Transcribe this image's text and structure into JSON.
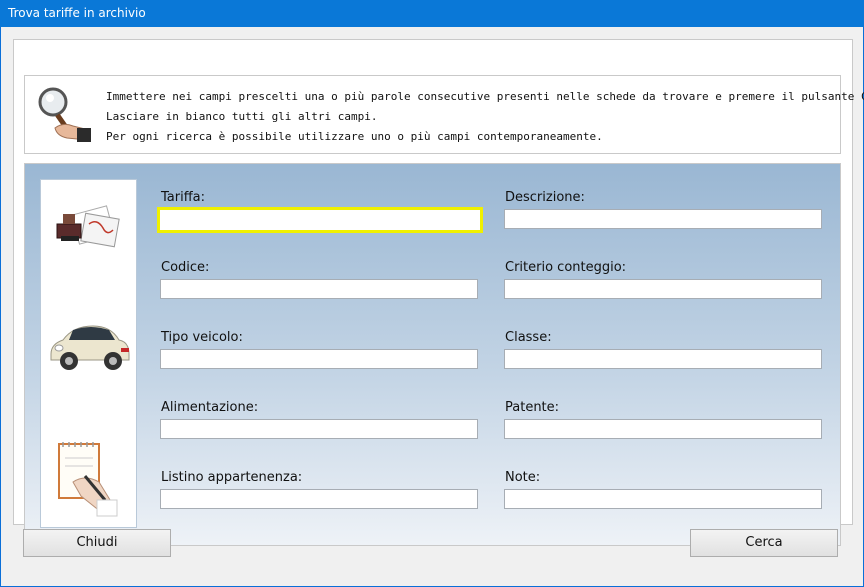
{
  "window": {
    "title": "Trova tariffe in archivio"
  },
  "info": {
    "lines": [
      "Immettere nei campi prescelti una o più parole consecutive presenti nelle schede da trovare e premere il pulsante Cerca.",
      "Lasciare in bianco tutti gli altri campi.",
      "Per ogni ricerca è possibile utilizzare uno o più campi contemporaneamente."
    ]
  },
  "fields": {
    "tariffa": {
      "label": "Tariffa:",
      "value": ""
    },
    "descrizione": {
      "label": "Descrizione:",
      "value": ""
    },
    "codice": {
      "label": "Codice:",
      "value": ""
    },
    "criterio": {
      "label": "Criterio conteggio:",
      "value": ""
    },
    "tipo_veicolo": {
      "label": "Tipo veicolo:",
      "value": ""
    },
    "classe": {
      "label": "Classe:",
      "value": ""
    },
    "alimentazione": {
      "label": "Alimentazione:",
      "value": ""
    },
    "patente": {
      "label": "Patente:",
      "value": ""
    },
    "listino": {
      "label": "Listino appartenenza:",
      "value": ""
    },
    "note": {
      "label": "Note:",
      "value": ""
    }
  },
  "buttons": {
    "close": "Chiudi",
    "search": "Cerca"
  },
  "icons": [
    "magnifier-hand-icon",
    "stamp-documents-icon",
    "car-icon",
    "notepad-writing-icon"
  ]
}
